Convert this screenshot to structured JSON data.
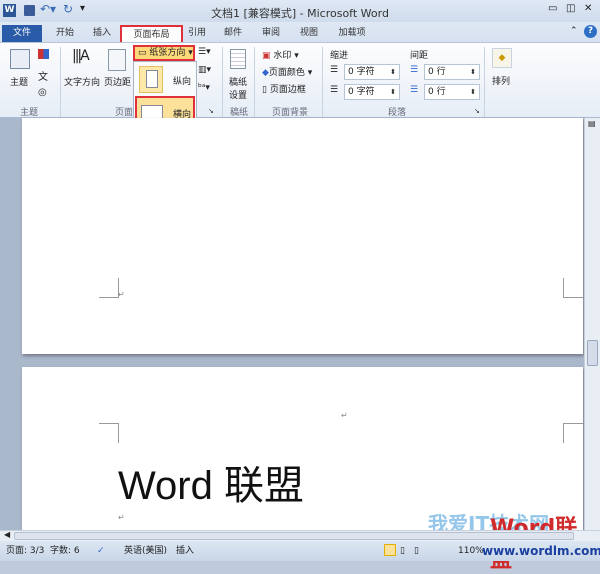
{
  "title": "文档1 [兼容模式] - Microsoft Word",
  "quick_access": {
    "app_icon": "W",
    "save": "save-icon",
    "undo": "undo-icon",
    "redo": "redo-icon"
  },
  "tabs": [
    "文件",
    "开始",
    "插入",
    "页面布局",
    "引用",
    "邮件",
    "审阅",
    "视图",
    "加载项"
  ],
  "ribbon": {
    "theme": {
      "label": "主题",
      "group": "主题"
    },
    "page_setup": {
      "text_direction": "文字方向",
      "margins": "页边距",
      "orientation": "纸张方向",
      "group": "页面"
    },
    "orientation_menu": {
      "portrait": "纵向",
      "landscape": "横向"
    },
    "manuscript": {
      "label1": "稿纸",
      "label2": "设置",
      "group": "稿纸"
    },
    "background": {
      "watermark": "水印",
      "page_color": "页面颜色",
      "page_border": "页面边框",
      "group": "页面背景"
    },
    "paragraph": {
      "indent": "缩进",
      "spacing": "间距",
      "indent_left": "0 字符",
      "indent_right": "0 字符",
      "space_before": "0 行",
      "space_after": "0 行",
      "group": "段落"
    },
    "arrange": {
      "label": "排列"
    }
  },
  "document": {
    "body_text": "Word 联盟",
    "para_mark": "↵"
  },
  "status": {
    "page": "页面: 3/3",
    "words": "字数: 6",
    "language": "英语(美国)",
    "mode": "插入",
    "zoom": "110%"
  },
  "watermark": {
    "text1": "我爱IT技术网",
    "text2": "Word联盟",
    "url": "www.wordlm.com"
  }
}
